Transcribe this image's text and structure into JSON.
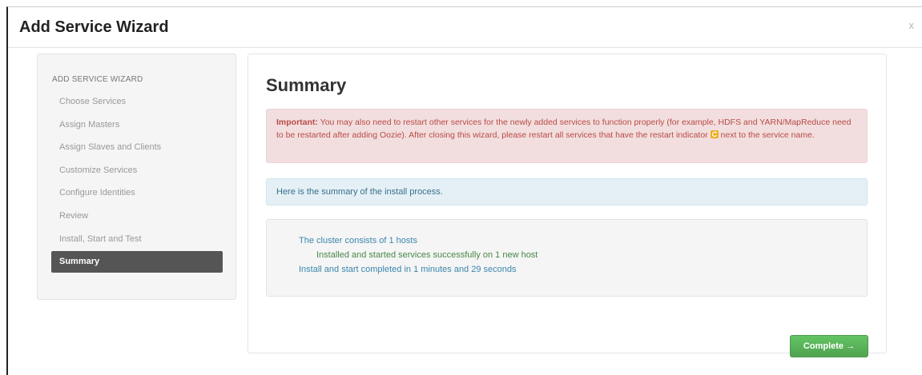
{
  "modal": {
    "title": "Add Service Wizard",
    "close_label": "x"
  },
  "nav": {
    "header": "ADD SERVICE WIZARD",
    "items": [
      {
        "label": "Choose Services",
        "active": false
      },
      {
        "label": "Assign Masters",
        "active": false
      },
      {
        "label": "Assign Slaves and Clients",
        "active": false
      },
      {
        "label": "Customize Services",
        "active": false
      },
      {
        "label": "Configure Identities",
        "active": false
      },
      {
        "label": "Review",
        "active": false
      },
      {
        "label": "Install, Start and Test",
        "active": false
      },
      {
        "label": "Summary",
        "active": true
      }
    ]
  },
  "content": {
    "title": "Summary",
    "important_label": "Important:",
    "important_text_1": "You may also need to restart other services for the newly added services to function properly (for example, HDFS and YARN/MapReduce need to be restarted after adding Oozie). After closing this wizard, please restart all services that have the restart indicator",
    "important_text_2": "next to the service name.",
    "info_text": "Here is the summary of the install process.",
    "summary": {
      "hosts": "The cluster consists of 1 hosts",
      "success": "Installed and started services successfully on 1 new host",
      "time": "Install and start completed in 1 minutes and 29 seconds"
    },
    "complete_button": "Complete →"
  },
  "colors": {
    "error_bg": "#f2dede",
    "error_text": "#b94a48",
    "info_bg": "#e4f0f6",
    "success_text": "#468847",
    "link_text": "#3a87ad",
    "button_green": "#51a351",
    "active_nav_bg": "#555555",
    "restart_icon": "#f0ad1e"
  },
  "icons": {
    "restart_indicator": "refresh-icon"
  }
}
